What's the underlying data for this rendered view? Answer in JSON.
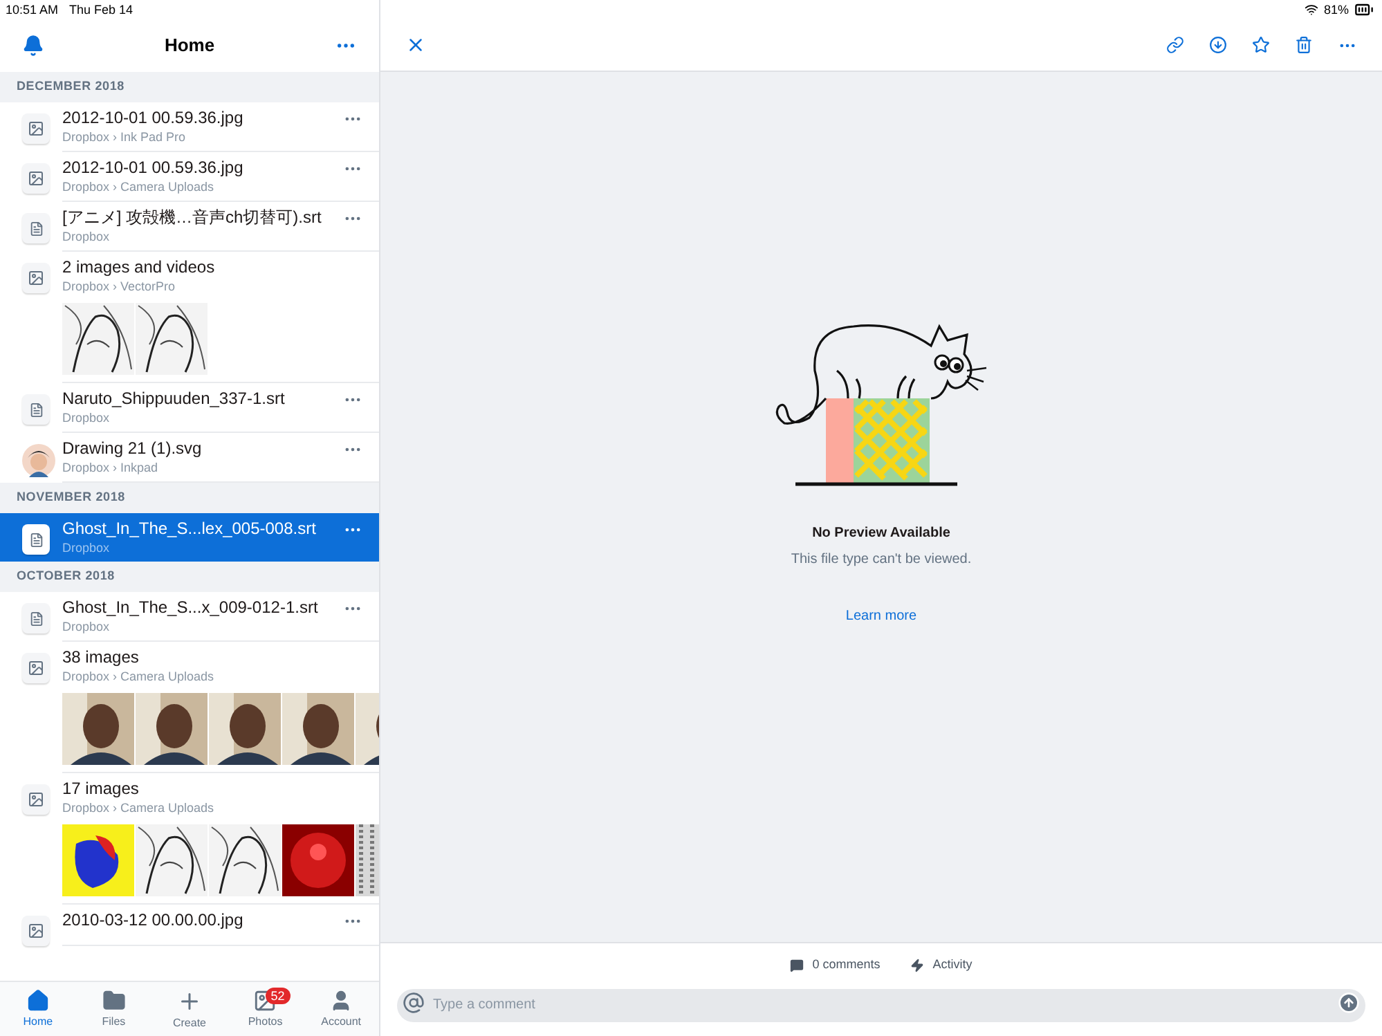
{
  "status_bar": {
    "time": "10:51 AM",
    "date": "Thu Feb 14",
    "battery": "81%"
  },
  "sidebar": {
    "title": "Home",
    "sections": [
      {
        "heading": "DECEMBER 2018",
        "items": [
          {
            "kind": "image-file",
            "name": "2012-10-01 00.59.36.jpg",
            "path": "Dropbox › Ink Pad Pro",
            "selected": false
          },
          {
            "kind": "image-file",
            "name": "2012-10-01 00.59.36.jpg",
            "path": "Dropbox › Camera Uploads",
            "selected": false
          },
          {
            "kind": "document-file",
            "name": "[アニメ] 攻殻機…音声ch切替可).srt",
            "path": "Dropbox",
            "selected": false
          },
          {
            "kind": "gallery",
            "name": "2 images and videos",
            "path": "Dropbox › VectorPro",
            "selected": false
          },
          {
            "kind": "document-file",
            "name": "Naruto_Shippuuden_337-1.srt",
            "path": "Dropbox",
            "selected": false
          },
          {
            "kind": "avatar-file",
            "name": "Drawing 21 (1).svg",
            "path": "Dropbox › Inkpad",
            "selected": false
          }
        ]
      },
      {
        "heading": "NOVEMBER 2018",
        "items": [
          {
            "kind": "document-file",
            "name": "Ghost_In_The_S...lex_005-008.srt",
            "path": "Dropbox",
            "selected": true
          }
        ]
      },
      {
        "heading": "OCTOBER 2018",
        "items": [
          {
            "kind": "document-file",
            "name": "Ghost_In_The_S...x_009-012-1.srt",
            "path": "Dropbox",
            "selected": false
          },
          {
            "kind": "gallery",
            "name": "38 images",
            "path": "Dropbox › Camera Uploads",
            "selected": false
          },
          {
            "kind": "gallery",
            "name": "17 images",
            "path": "Dropbox › Camera Uploads",
            "selected": false
          },
          {
            "kind": "image-file",
            "name": "2010-03-12 00.00.00.jpg",
            "selected": false
          }
        ]
      }
    ]
  },
  "tabs": [
    {
      "label": "Home",
      "selected": true
    },
    {
      "label": "Files",
      "selected": false
    },
    {
      "label": "Create",
      "selected": false
    },
    {
      "label": "Photos",
      "selected": false,
      "badge": "52"
    },
    {
      "label": "Account",
      "selected": false
    }
  ],
  "preview": {
    "title": "No Preview Available",
    "message": "This file type can't be viewed.",
    "link": "Learn more"
  },
  "comments": {
    "count": "0 comments",
    "activity": "Activity",
    "placeholder": "Type a comment"
  }
}
